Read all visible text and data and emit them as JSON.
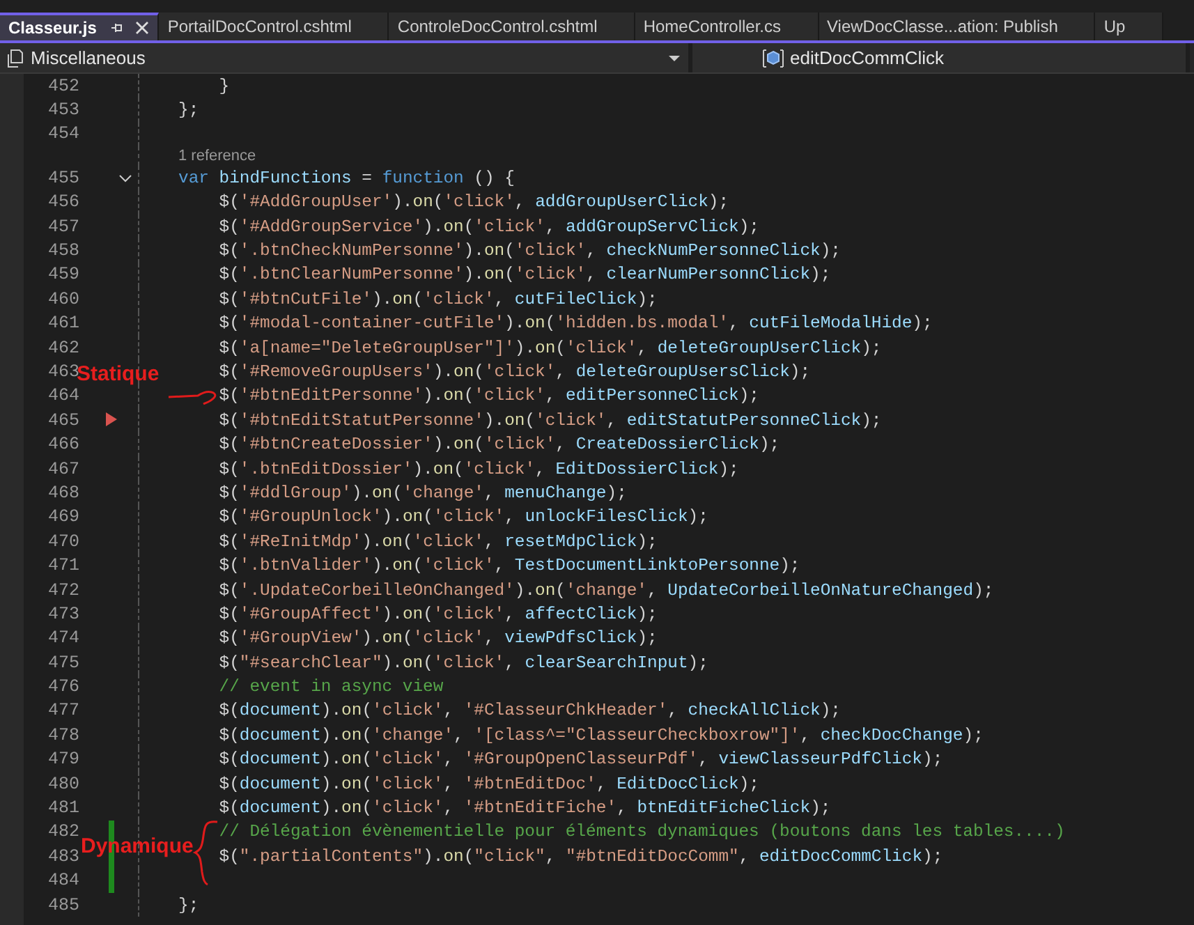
{
  "tabs": [
    {
      "label": "Classeur.js",
      "selected": true
    },
    {
      "label": "PortailDocControl.cshtml",
      "selected": false
    },
    {
      "label": "ControleDocControl.cshtml",
      "selected": false
    },
    {
      "label": "HomeController.cs",
      "selected": false
    },
    {
      "label": "ViewDocClasse...ation: Publish",
      "selected": false
    },
    {
      "label": "Up",
      "selected": false
    }
  ],
  "nav": {
    "scope": "Miscellaneous",
    "member": "editDocCommClick"
  },
  "lines": [
    {
      "number": "452",
      "code": "    }",
      "changed": false,
      "marker": false
    },
    {
      "number": "453",
      "code": "};",
      "changed": false,
      "marker": false
    },
    {
      "number": "454",
      "changed": false,
      "marker": false
    },
    {
      "number": "455",
      "code": "var bindFunctions = function () {",
      "codelens": "1 reference",
      "foldable": true,
      "changed": false,
      "marker": false
    },
    {
      "number": "456",
      "code": "    $('#AddGroupUser').on('click', addGroupUserClick);",
      "changed": false,
      "marker": false
    },
    {
      "number": "457",
      "code": "    $('#AddGroupService').on('click', addGroupServClick);",
      "changed": false,
      "marker": false
    },
    {
      "number": "458",
      "code": "    $('.btnCheckNumPersonne').on('click', checkNumPersonneClick);",
      "changed": false,
      "marker": false
    },
    {
      "number": "459",
      "code": "    $('.btnClearNumPersonne').on('click', clearNumPersonnClick);",
      "changed": false,
      "marker": false
    },
    {
      "number": "460",
      "code": "    $('#btnCutFile').on('click', cutFileClick);",
      "changed": false,
      "marker": false
    },
    {
      "number": "461",
      "code": "    $('#modal-container-cutFile').on('hidden.bs.modal', cutFileModalHide);",
      "changed": false,
      "marker": false
    },
    {
      "number": "462",
      "code": "    $('a[name=\"DeleteGroupUser\"]').on('click', deleteGroupUserClick);",
      "changed": false,
      "marker": false
    },
    {
      "number": "463",
      "code": "    $('#RemoveGroupUsers').on('click', deleteGroupUsersClick);",
      "changed": false,
      "marker": false
    },
    {
      "number": "464",
      "code": "    $('#btnEditPersonne').on('click', editPersonneClick);",
      "changed": false,
      "marker": false
    },
    {
      "number": "465",
      "code": "    $('#btnEditStatutPersonne').on('click', editStatutPersonneClick);",
      "changed": false,
      "marker": true
    },
    {
      "number": "466",
      "code": "    $('#btnCreateDossier').on('click', CreateDossierClick);",
      "changed": false,
      "marker": false
    },
    {
      "number": "467",
      "code": "    $('.btnEditDossier').on('click', EditDossierClick);",
      "changed": false,
      "marker": false
    },
    {
      "number": "468",
      "code": "    $('#ddlGroup').on('change', menuChange);",
      "changed": false,
      "marker": false
    },
    {
      "number": "469",
      "code": "    $('#GroupUnlock').on('click', unlockFilesClick);",
      "changed": false,
      "marker": false
    },
    {
      "number": "470",
      "code": "    $('#ReInitMdp').on('click', resetMdpClick);",
      "changed": false,
      "marker": false
    },
    {
      "number": "471",
      "code": "    $('.btnValider').on('click', TestDocumentLinktoPersonne);",
      "changed": false,
      "marker": false
    },
    {
      "number": "472",
      "code": "    $('.UpdateCorbeilleOnChanged').on('change', UpdateCorbeilleOnNatureChanged);",
      "changed": false,
      "marker": false
    },
    {
      "number": "473",
      "code": "    $('#GroupAffect').on('click', affectClick);",
      "changed": false,
      "marker": false
    },
    {
      "number": "474",
      "code": "    $('#GroupView').on('click', viewPdfsClick);",
      "changed": false,
      "marker": false
    },
    {
      "number": "475",
      "code": "    $(\"#searchClear\").on('click', clearSearchInput);",
      "changed": false,
      "marker": false
    },
    {
      "number": "476",
      "code": "    // event in async view",
      "changed": false,
      "marker": false
    },
    {
      "number": "477",
      "code": "    $(document).on('click', '#ClasseurChkHeader', checkAllClick);",
      "changed": false,
      "marker": false
    },
    {
      "number": "478",
      "code": "    $(document).on('change', '[class^=\"ClasseurCheckboxrow\"]', checkDocChange);",
      "changed": false,
      "marker": false
    },
    {
      "number": "479",
      "code": "    $(document).on('click', '#GroupOpenClasseurPdf', viewClasseurPdfClick);",
      "changed": false,
      "marker": false
    },
    {
      "number": "480",
      "code": "    $(document).on('click', '#btnEditDoc', EditDocClick);",
      "changed": false,
      "marker": false
    },
    {
      "number": "481",
      "code": "    $(document).on('click', '#btnEditFiche', btnEditFicheClick);",
      "changed": false,
      "marker": false
    },
    {
      "number": "482",
      "code": "    // Délégation évènementielle pour éléments dynamiques (boutons dans les tables....)",
      "changed": true,
      "marker": false
    },
    {
      "number": "483",
      "code": "    $(\".partialContents\").on(\"click\", \"#btnEditDocComm\", editDocCommClick);",
      "changed": true,
      "marker": false
    },
    {
      "number": "484",
      "changed": true,
      "marker": false
    },
    {
      "number": "485",
      "code": "};",
      "changed": false,
      "marker": false
    }
  ],
  "annotations": [
    {
      "kind": "static",
      "text": "Statique"
    },
    {
      "kind": "dynamic",
      "text": "Dynamique"
    }
  ]
}
